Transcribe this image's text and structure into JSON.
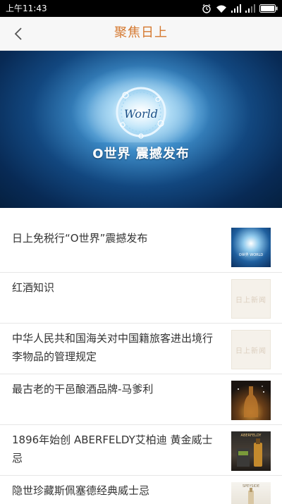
{
  "status": {
    "time": "上午11:43"
  },
  "header": {
    "title": "聚焦日上"
  },
  "banner": {
    "caption": "O世界 震撼发布",
    "logo_text": "World",
    "dots": 6,
    "active_dot": 0
  },
  "news": [
    {
      "title": "日上免税行“O世界”震撼发布",
      "thumb": "o-world-thumbnail",
      "thumb_text": "O世界 WORLD"
    },
    {
      "title": "红酒知识",
      "thumb": "placeholder",
      "thumb_text": "日上新闻"
    },
    {
      "title": "中华人民共和国海关对中国籍旅客进出境行李物品的管理规定",
      "thumb": "placeholder",
      "thumb_text": "日上新闻"
    },
    {
      "title": "最古老的干邑酿酒品牌-马爹利",
      "thumb": "cognac-bottle-thumbnail"
    },
    {
      "title": "1896年始创 ABERFELDY艾柏迪 黄金威士忌",
      "thumb": "aberfeldy-thumbnail",
      "thumb_text": "ABERFELDY"
    },
    {
      "title": "隐世珍藏斯佩塞德经典威士忌",
      "thumb": "whisky-thumbnail",
      "thumb_text": "SPEYSIDE"
    }
  ],
  "colors": {
    "accent": "#d5782f",
    "active_dot": "#e0782c",
    "status_bar": "#000000"
  }
}
